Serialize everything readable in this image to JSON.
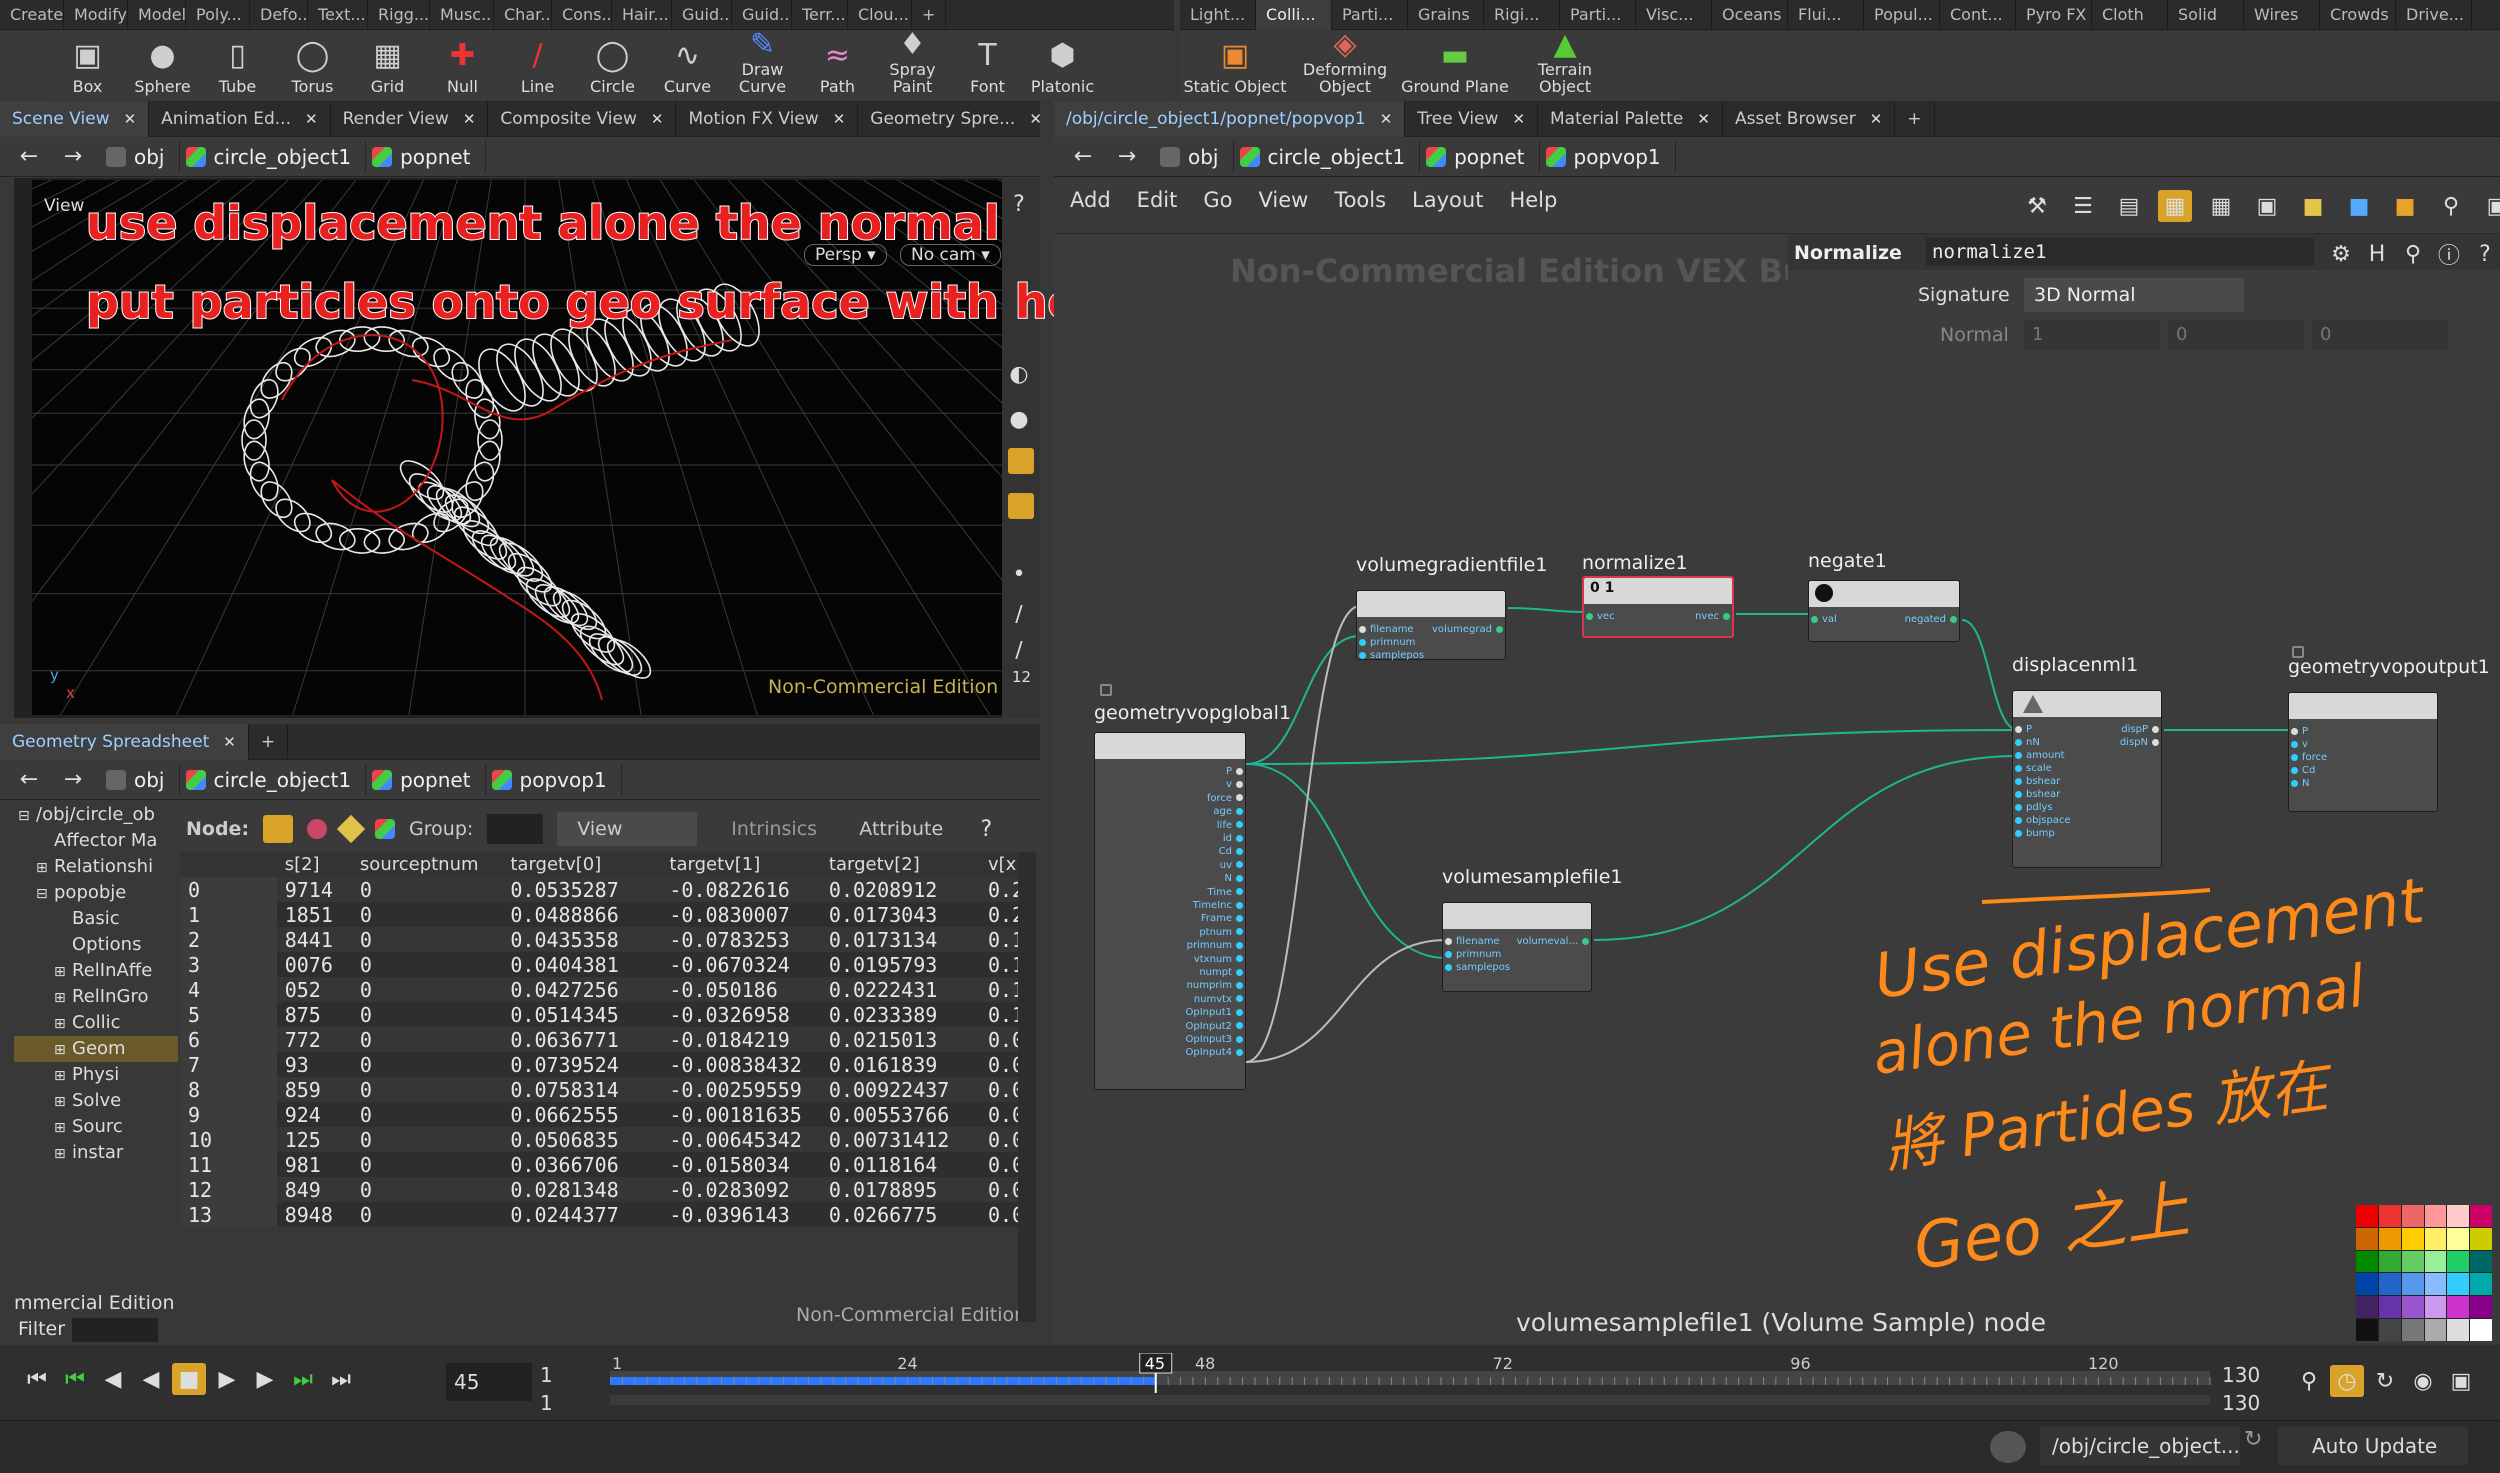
{
  "shelf_tabs_left": [
    "Create",
    "Modify",
    "Model",
    "Poly...",
    "Defo...",
    "Text...",
    "Rigg...",
    "Musc...",
    "Char...",
    "Cons...",
    "Hair...",
    "Guid...",
    "Guid...",
    "Terr...",
    "Clou..."
  ],
  "shelf_tabs_right": [
    "Light...",
    "Colli...",
    "Parti...",
    "Grains",
    "Rigi...",
    "Parti...",
    "Visc...",
    "Oceans",
    "Flui...",
    "Popul...",
    "Cont...",
    "Pyro FX",
    "Cloth",
    "Solid",
    "Wires",
    "Crowds",
    "Drive..."
  ],
  "shelf_plus": "+",
  "tools_left": [
    {
      "label": "Box",
      "icon": "box-icon"
    },
    {
      "label": "Sphere",
      "icon": "sphere-icon"
    },
    {
      "label": "Tube",
      "icon": "tube-icon"
    },
    {
      "label": "Torus",
      "icon": "torus-icon"
    },
    {
      "label": "Grid",
      "icon": "grid-icon"
    },
    {
      "label": "Null",
      "icon": "null-icon"
    },
    {
      "label": "Line",
      "icon": "line-icon"
    },
    {
      "label": "Circle",
      "icon": "circle-icon"
    },
    {
      "label": "Curve",
      "icon": "curve-icon"
    },
    {
      "label": "Draw Curve",
      "icon": "draw-curve-icon"
    },
    {
      "label": "Path",
      "icon": "path-icon"
    },
    {
      "label": "Spray Paint",
      "icon": "spray-paint-icon"
    },
    {
      "label": "Font",
      "icon": "font-icon"
    },
    {
      "label": "Platonic",
      "icon": "platonic-icon"
    }
  ],
  "tools_right": [
    {
      "label": "Static Object",
      "icon": "static-object-icon"
    },
    {
      "label": "Deforming\nObject",
      "icon": "deforming-object-icon"
    },
    {
      "label": "Ground Plane",
      "icon": "ground-plane-icon"
    },
    {
      "label": "Terrain\nObject",
      "icon": "terrain-object-icon"
    }
  ],
  "left_pane_tabs": [
    "Scene View",
    "Animation Ed...",
    "Render View",
    "Composite View",
    "Motion FX View",
    "Geometry Spre..."
  ],
  "right_pane_tabs": [
    "/obj/circle_object1/popnet/popvop1",
    "Tree View",
    "Material Palette",
    "Asset Browser"
  ],
  "left_path": [
    "obj",
    "circle_object1",
    "popnet"
  ],
  "right_path": [
    "obj",
    "circle_object1",
    "popnet",
    "popvop1"
  ],
  "viewport": {
    "label": "View",
    "persp": "Persp ▾",
    "cam": "No cam ▾",
    "watermark": "Non-Commercial Edition",
    "scale": "12",
    "axis_x": "x",
    "axis_y": "y"
  },
  "overlay_text": [
    "use displacement alone the normal",
    "put particles onto geo surface with help with volume gradient and Sample"
  ],
  "vex_watermark": "Non-Commercial Edition VEX Builder",
  "spreadsheet": {
    "tab": "Geometry Spreadsheet",
    "path": [
      "obj",
      "circle_object1",
      "popnet",
      "popvop1"
    ],
    "node_label": "Node:",
    "group_label": "Group:",
    "view_label": "View",
    "intrinsics_label": "Intrinsics",
    "attribute_label": "Attribute",
    "columns": [
      "",
      "s[2]",
      "sourceptnum",
      "targetv[0]",
      "targetv[1]",
      "targetv[2]",
      "v[x]"
    ],
    "rows": [
      [
        "0",
        "9714",
        "0",
        "0.0535287",
        "-0.0822616",
        "0.0208912",
        "0.2"
      ],
      [
        "1",
        "1851",
        "0",
        "0.0488866",
        "-0.0830007",
        "0.0173043",
        "0.2"
      ],
      [
        "2",
        "8441",
        "0",
        "0.0435358",
        "-0.0783253",
        "0.0173134",
        "0.1"
      ],
      [
        "3",
        "0076",
        "0",
        "0.0404381",
        "-0.0670324",
        "0.0195793",
        "0.1"
      ],
      [
        "4",
        "052",
        "0",
        "0.0427256",
        "-0.050186",
        "0.0222431",
        "0.1"
      ],
      [
        "5",
        "875",
        "0",
        "0.0514345",
        "-0.0326958",
        "0.0233389",
        "0.1"
      ],
      [
        "6",
        "772",
        "0",
        "0.0636771",
        "-0.0184219",
        "0.0215013",
        "0.0"
      ],
      [
        "7",
        "93",
        "0",
        "0.0739524",
        "-0.00838432",
        "0.0161839",
        "0.0"
      ],
      [
        "8",
        "859",
        "0",
        "0.0758314",
        "-0.00259559",
        "0.00922437",
        "0.0"
      ],
      [
        "9",
        "924",
        "0",
        "0.0662555",
        "-0.00181635",
        "0.00553766",
        "0.0"
      ],
      [
        "10",
        "125",
        "0",
        "0.0506835",
        "-0.00645342",
        "0.00731412",
        "0.0"
      ],
      [
        "11",
        "981",
        "0",
        "0.0366706",
        "-0.0158034",
        "0.0118164",
        "0.0"
      ],
      [
        "12",
        "849",
        "0",
        "0.0281348",
        "-0.0283092",
        "0.0178895",
        "0.0"
      ],
      [
        "13",
        "8948",
        "0",
        "0.0244377",
        "-0.0396143",
        "0.0266775",
        "0.0"
      ]
    ],
    "watermark": "Non-Commercial Edition"
  },
  "tree": {
    "items": [
      {
        "label": "/obj/circle_ob",
        "indent": 0,
        "exp": "⊟"
      },
      {
        "label": "Affector Ma",
        "indent": 1,
        "exp": ""
      },
      {
        "label": "Relationshi",
        "indent": 1,
        "exp": "⊞"
      },
      {
        "label": "popobje",
        "indent": 1,
        "exp": "⊟"
      },
      {
        "label": "Basic",
        "indent": 2,
        "exp": ""
      },
      {
        "label": "Options",
        "indent": 2,
        "exp": ""
      },
      {
        "label": "RelInAffe",
        "indent": 2,
        "exp": "⊞"
      },
      {
        "label": "RelInGro",
        "indent": 2,
        "exp": "⊞"
      },
      {
        "label": "Collic",
        "indent": 2,
        "exp": "⊞"
      },
      {
        "label": "Geom",
        "indent": 2,
        "exp": "⊞"
      },
      {
        "label": "Physi",
        "indent": 2,
        "exp": "⊞"
      },
      {
        "label": "Solve",
        "indent": 2,
        "exp": "⊞"
      },
      {
        "label": "Sourc",
        "indent": 2,
        "exp": "⊞"
      },
      {
        "label": "instar",
        "indent": 2,
        "exp": "⊞"
      }
    ],
    "edition": "mmercial Edition",
    "filter": "Filter"
  },
  "net_menu": [
    "Add",
    "Edit",
    "Go",
    "View",
    "Tools",
    "Layout",
    "Help"
  ],
  "params": {
    "type": "Normalize",
    "name": "normalize1",
    "signature_label": "Signature",
    "signature_value": "3D Normal",
    "normal_label": "Normal",
    "normal_values": [
      "1",
      "0",
      "0"
    ]
  },
  "nodes": {
    "volumegradient": {
      "title": "volumegradientfile1",
      "inputs": [
        "filename",
        "primnum",
        "samplepos"
      ],
      "output": "volumegrad"
    },
    "normalize": {
      "title": "normalize1",
      "input": "vec",
      "output": "nvec",
      "badge": "0 1"
    },
    "negate": {
      "title": "negate1",
      "input": "val",
      "output": "negated"
    },
    "geoglobal": {
      "title": "geometryvopglobal1",
      "outputs": [
        "P",
        "v",
        "force",
        "age",
        "life",
        "id",
        "Cd",
        "uv",
        "N",
        "Time",
        "TimeInc",
        "Frame",
        "ptnum",
        "primnum",
        "vtxnum",
        "numpt",
        "numprim",
        "numvtx",
        "OpInput1",
        "OpInput2",
        "OpInput3",
        "OpInput4"
      ]
    },
    "volumesample": {
      "title": "volumesamplefile1",
      "inputs": [
        "filename",
        "primnum",
        "samplepos"
      ],
      "output": "volumeval..."
    },
    "displace": {
      "title": "displacenml1",
      "inputs": [
        "P",
        "nN",
        "amount",
        "scale",
        "bshear",
        "bshear",
        "pdlys",
        "objspace",
        "bump"
      ],
      "outputs": [
        "dispP",
        "dispN"
      ]
    },
    "geooutput": {
      "title": "geometryvopoutput1",
      "inputs": [
        "P",
        "v",
        "force",
        "Cd",
        "N"
      ]
    }
  },
  "net_status": "volumesamplefile1 (Volume Sample) node",
  "handwriting": [
    "Use displacement",
    "alone the normal",
    "將 Partides 放在",
    "Geo 之上"
  ],
  "palette": [
    "#e00",
    "#e33",
    "#e66",
    "#f99",
    "#fcc",
    "#c06",
    "#c60",
    "#e90",
    "#fc0",
    "#fe6",
    "#ff9",
    "#cc0",
    "#080",
    "#3a3",
    "#6c6",
    "#9e9",
    "#2c6",
    "#066",
    "#04a",
    "#26c",
    "#59e",
    "#8bf",
    "#3cf",
    "#0aa",
    "#426",
    "#63a",
    "#95c",
    "#c9e",
    "#c3c",
    "#808",
    "#111",
    "#444",
    "#777",
    "#aaa",
    "#ddd",
    "#fff"
  ],
  "timeline": {
    "frame": "45",
    "start": "1",
    "start2": "1",
    "end": "130",
    "end2": "130",
    "ticks": [
      "1",
      "24",
      "48",
      "72",
      "96",
      "120"
    ],
    "current_marker": "45"
  },
  "status": {
    "path": "/obj/circle_object...",
    "auto_update": "Auto Update"
  },
  "colors": {
    "accent": "#2b78ff",
    "overlay_red": "#e82020",
    "handwriting": "#ff8a1c",
    "node_header": "#d8d8d8",
    "wire": "#1fb58f"
  }
}
